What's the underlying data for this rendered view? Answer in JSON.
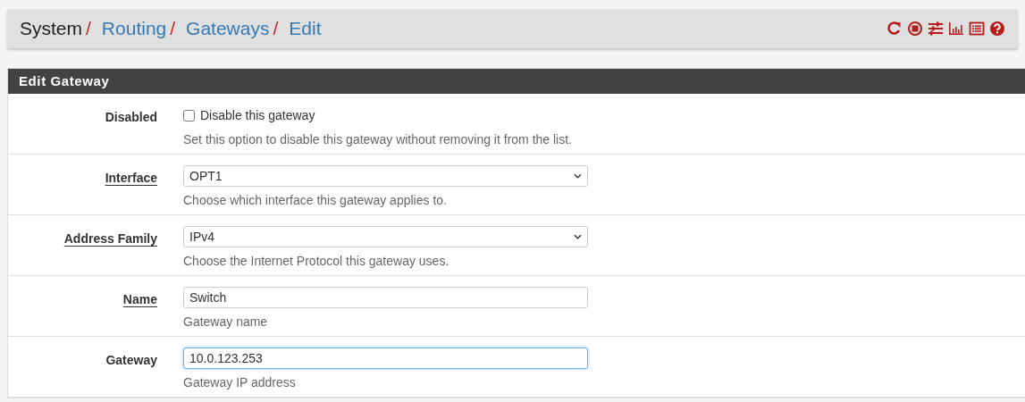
{
  "breadcrumb": [
    {
      "text": "System",
      "link": false,
      "separator": "/"
    },
    {
      "text": "Routing",
      "link": true,
      "separator": "/"
    },
    {
      "text": "Gateways",
      "link": true,
      "separator": "/"
    },
    {
      "text": "Edit",
      "link": true
    }
  ],
  "toolbar": [
    {
      "kind": "reload"
    },
    {
      "kind": "stop"
    },
    {
      "kind": "sliders"
    },
    {
      "kind": "chart"
    },
    {
      "kind": "list"
    },
    {
      "kind": "help"
    }
  ],
  "panel": {
    "title": "Edit Gateway",
    "rows": [
      {
        "label": "Disabled",
        "required": false,
        "kind": "checkbox",
        "checked": false,
        "option": "Disable this gateway",
        "help": "Set this option to disable this gateway without removing it from the list."
      },
      {
        "label": "Interface",
        "required": true,
        "kind": "select",
        "value": "OPT1",
        "help": "Choose which interface this gateway applies to."
      },
      {
        "label": "Address Family",
        "required": true,
        "kind": "select",
        "value": "IPv4",
        "help": "Choose the Internet Protocol this gateway uses."
      },
      {
        "label": "Name",
        "required": true,
        "kind": "text",
        "value": "Switch",
        "focused": false,
        "help": "Gateway name"
      },
      {
        "label": "Gateway",
        "required": false,
        "kind": "text",
        "value": "10.0.123.253",
        "focused": true,
        "help": "Gateway IP address"
      }
    ]
  }
}
